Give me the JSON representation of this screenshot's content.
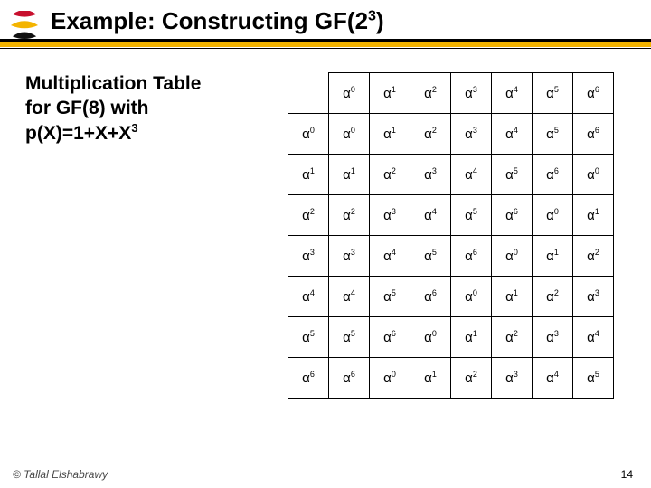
{
  "header": {
    "title_pre": "Example: Constructing GF(2",
    "title_sup": "3",
    "title_post": ")"
  },
  "subtitle": {
    "line1": "Multiplication Table",
    "line2": "for GF(8) with",
    "line3_pre": "p(X)=1+X+X",
    "line3_sup": "3"
  },
  "table": {
    "alpha": "α",
    "size": 7
  },
  "chart_data": {
    "type": "table",
    "title": "GF(8) multiplication table, exponents of α (mod 7)",
    "headers": [
      0,
      1,
      2,
      3,
      4,
      5,
      6
    ],
    "rows": [
      [
        0,
        1,
        2,
        3,
        4,
        5,
        6
      ],
      [
        1,
        2,
        3,
        4,
        5,
        6,
        0
      ],
      [
        2,
        3,
        4,
        5,
        6,
        0,
        1
      ],
      [
        3,
        4,
        5,
        6,
        0,
        1,
        2
      ],
      [
        4,
        5,
        6,
        0,
        1,
        2,
        3
      ],
      [
        5,
        6,
        0,
        1,
        2,
        3,
        4
      ],
      [
        6,
        0,
        1,
        2,
        3,
        4,
        5
      ]
    ]
  },
  "footer": {
    "copyright": "© Tallal Elshabrawy",
    "page": "14"
  }
}
